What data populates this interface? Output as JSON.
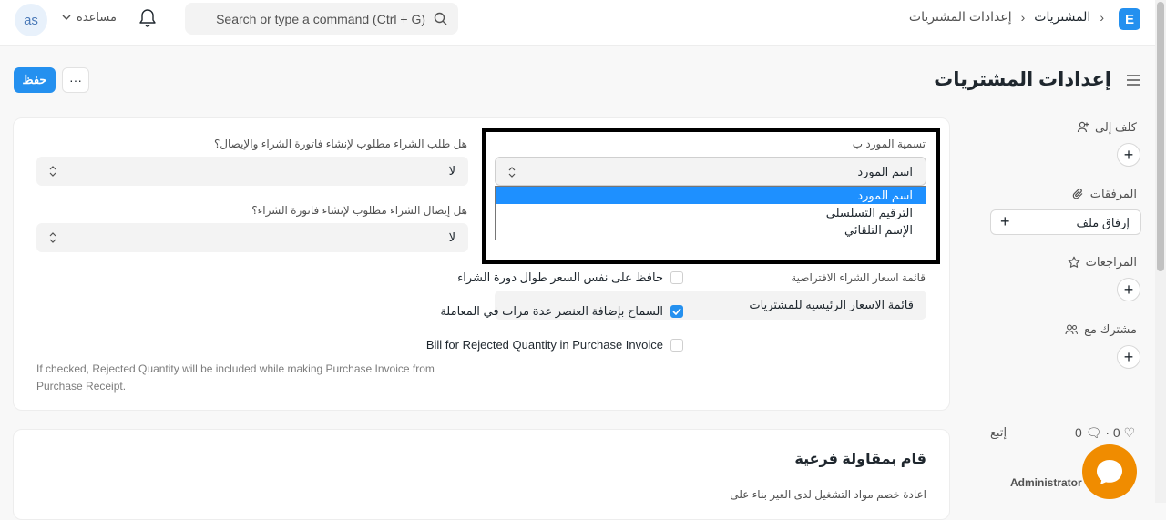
{
  "navbar": {
    "avatar_initials": "as",
    "help_label": "مساعدة",
    "search_placeholder": "Search or type a command (Ctrl + G)",
    "breadcrumbs": [
      "المشتريات",
      "إعدادات المشتريات"
    ],
    "logo_letter": "E"
  },
  "toolbar": {
    "save_label": "حفظ",
    "more_label": "···",
    "page_title": "إعدادات المشتريات"
  },
  "sidebar": {
    "assign_label": "كلف إلى",
    "attachments_label": "المرفقات",
    "attach_file_label": "إرفاق ملف",
    "reviews_label": "المراجعات",
    "shared_label": "مشترك مع",
    "follow_label": "إتبع",
    "likes_count": "0",
    "comments_count": "0",
    "admin_label": "Administrator"
  },
  "form": {
    "supplier_naming": {
      "label": "تسمية المورد ب",
      "value": "اسم المورد",
      "options": [
        "اسم المورد",
        "الترقيم التسلسلي",
        "الإسم التلقائي"
      ]
    },
    "default_price_list": {
      "label": "قائمة اسعار الشراء الافتراضية",
      "value": "قائمة الاسعار الرئيسيه للمشتريات"
    },
    "po_required": {
      "label": "هل طلب الشراء مطلوب لإنشاء فاتورة الشراء والإيصال؟",
      "value": "لا"
    },
    "pr_required": {
      "label": "هل إيصال الشراء مطلوب لإنشاء فاتورة الشراء؟",
      "value": "لا"
    },
    "checkboxes": [
      {
        "label": "حافظ على نفس السعر طوال دورة الشراء",
        "checked": false
      },
      {
        "label": "السماح بإضافة العنصر عدة مرات في المعاملة",
        "checked": true
      },
      {
        "label": "Bill for Rejected Quantity in Purchase Invoice",
        "checked": false
      }
    ],
    "rejected_desc": "If checked, Rejected Quantity will be included while making Purchase Invoice from Purchase Receipt."
  },
  "subcontract": {
    "title": "قام بمقاولة فرعية",
    "subtitle": "اعادة خصم مواد التشغيل لدى الغير بناء على"
  },
  "colors": {
    "primary": "#2490ef",
    "chat": "#f08c00",
    "dropdown_selected": "#1e90ff"
  }
}
